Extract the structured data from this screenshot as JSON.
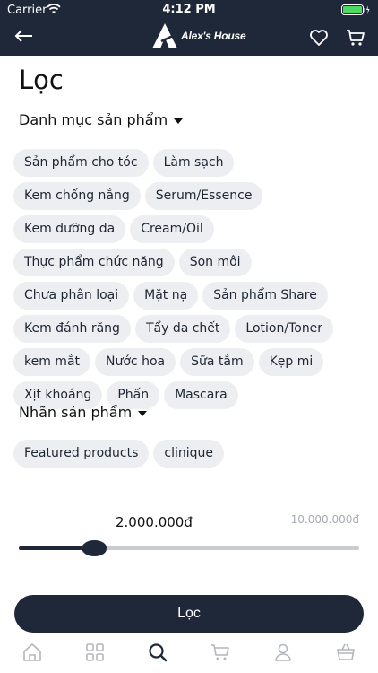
{
  "status_bar": {
    "carrier": "Carrier",
    "time": "4:12 PM"
  },
  "header": {
    "logo_text": "Alex's House",
    "background": "#1f2838"
  },
  "page": {
    "title": "Lọc"
  },
  "categories": {
    "heading": "Danh mục sản phẩm",
    "items": [
      "Sản phẩm cho tóc",
      "Làm sạch",
      "Kem chống nắng",
      "Serum/Essence",
      "Kem dưỡng da",
      "Cream/Oil",
      "Thực phẩm chức năng",
      "Son môi",
      "Chưa phân loại",
      "Mặt nạ",
      "Sản phẩm Share",
      "Kem đánh răng",
      "Tẩy da chết",
      "Lotion/Toner",
      "kem mắt",
      "Nước hoa",
      "Sữa tắm",
      "Kẹp mi",
      "Xịt khoáng",
      "Phấn",
      "Mascara"
    ]
  },
  "tags": {
    "heading": "Nhãn sản phẩm",
    "items": [
      "Featured products",
      "clinique"
    ]
  },
  "price": {
    "value_label": "2.000.000đ",
    "max_label": "10.000.000đ",
    "value": 2000000,
    "max": 10000000
  },
  "filter_button": {
    "label": "Lọc"
  },
  "tabbar": {
    "icons": [
      "home-icon",
      "grid-icon",
      "search-icon",
      "cart-icon",
      "user-icon",
      "basket-icon"
    ],
    "active": "search-icon"
  },
  "colors": {
    "accent": "#1f2838",
    "chip_bg": "#eceef1"
  }
}
